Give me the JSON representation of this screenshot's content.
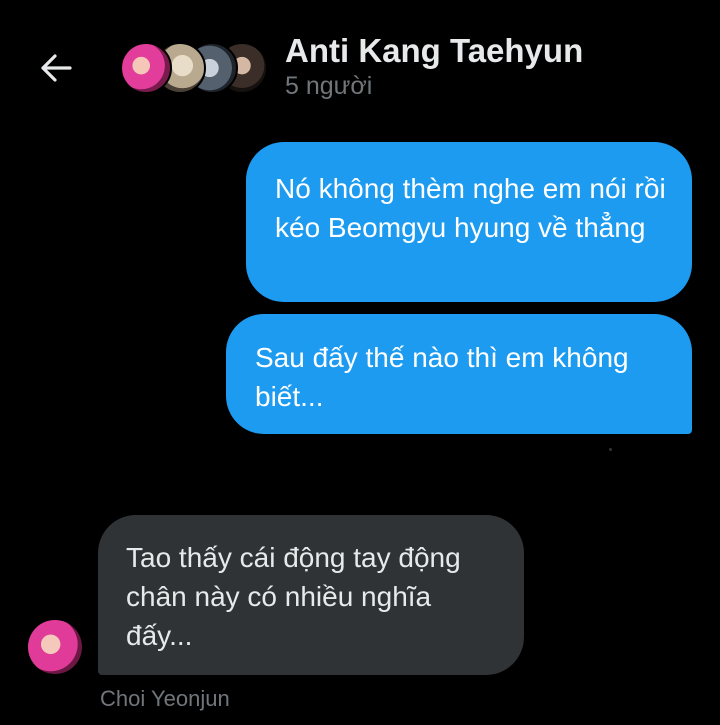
{
  "header": {
    "back_icon": "arrow-left-icon",
    "title": "Anti Kang Taehyun",
    "subtitle": "5 người",
    "avatar_icons": [
      "group-avatar-1",
      "group-avatar-2",
      "group-avatar-3",
      "group-avatar-4"
    ]
  },
  "messages": [
    {
      "direction": "outgoing",
      "text": "Nó không thèm nghe em nói rồi kéo Beomgyu hyung về thẳng"
    },
    {
      "direction": "outgoing",
      "text": "Sau đấy thế nào thì em không biết..."
    },
    {
      "direction": "incoming",
      "text": "Tao thấy cái động tay động chân này có nhiều nghĩa đấy...",
      "sender": "Choi Yeonjun"
    }
  ],
  "colors": {
    "background": "#000000",
    "outgoing_bubble": "#1d9bf0",
    "incoming_bubble": "#2f3336",
    "secondary_text": "#71767b"
  }
}
